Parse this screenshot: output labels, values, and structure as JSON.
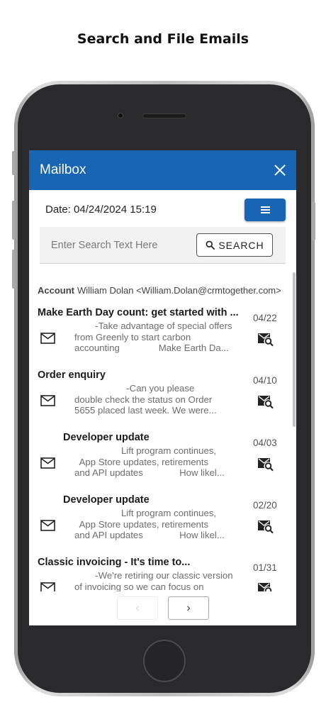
{
  "page": {
    "caption": "Search and File Emails"
  },
  "mailbox": {
    "title": "Mailbox",
    "date_label": "Date: 04/24/2024 15:19",
    "search": {
      "placeholder": "Enter Search Text Here",
      "button_label": "SEARCH"
    },
    "account": {
      "label": "Account",
      "value": "William Dolan <William.Dolan@crmtogether.com>"
    },
    "emails": [
      {
        "subject": "Make Earth Day count: get started with ...",
        "date": "04/22",
        "preview": [
          "        -Take advantage of special offers",
          "from Greenly to start carbon",
          "accounting               Make Earth Da..."
        ]
      },
      {
        "subject": "Order enquiry",
        "date": "04/10",
        "preview": [
          "                    -Can you please",
          "double check the status on Order",
          "5655 placed last week. We were..."
        ]
      },
      {
        "subject": "Developer update",
        "date": "04/03",
        "preview": [
          "                  Lift program continues,",
          "  App Store updates, retirements",
          "and API updates              How likel..."
        ]
      },
      {
        "subject": "Developer update",
        "date": "02/20",
        "preview": [
          "                  Lift program continues,",
          "  App Store updates, retirements",
          "and API updates              How likel..."
        ]
      },
      {
        "subject": "Classic invoicing                - It's time to...",
        "date": "01/31",
        "preview": [
          "        -We're retiring our classic version",
          "of invoicing so we can focus on"
        ]
      }
    ],
    "pager": {
      "prev": "‹",
      "next": "›"
    }
  },
  "icons": {
    "close": "close-icon",
    "menu": "menu-icon",
    "search": "search-icon",
    "envelope": "envelope-icon",
    "file_email": "mail-search-icon"
  },
  "colors": {
    "primary": "#1765b3",
    "text": "#1c1c1c",
    "muted": "#6e6e6e"
  }
}
